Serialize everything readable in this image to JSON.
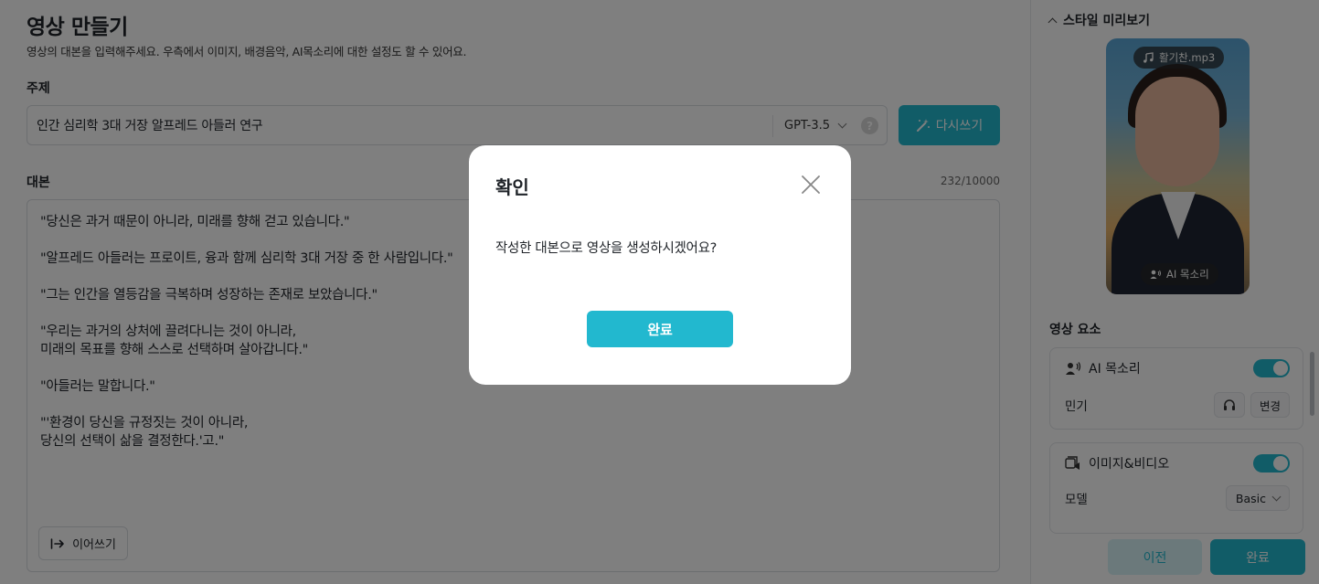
{
  "page": {
    "title": "영상 만들기",
    "description": "영상의 대본을 입력해주세요. 우측에서 이미지, 배경음악, AI목소리에 대한 설정도 할 수 있어요."
  },
  "topic": {
    "label": "주제",
    "value": "인간 심리학 3대 거장 알프레드 아들러 연구",
    "model": "GPT-3.5",
    "help": "?",
    "rewrite_label": "다시쓰기"
  },
  "script": {
    "label": "대본",
    "count": "232/10000",
    "lines": [
      "\"당신은 과거 때문이 아니라, 미래를 향해 걷고 있습니다.\"",
      "",
      "\"알프레드 아들러는 프로이트, 융과 함께 심리학 3대 거장 중 한 사람입니다.\"",
      "",
      "\"그는 인간을 열등감을 극복하며 성장하는 존재로 보았습니다.\"",
      "",
      "\"우리는 과거의 상처에 끌려다니는 것이 아니라,",
      "미래의 목표를 향해 스스로 선택하며 살아갑니다.\"",
      "",
      "\"아들러는 말합니다.\"",
      "",
      "\"'환경이 당신을 규정짓는 것이 아니라,",
      "당신의 선택이 삶을 결정한다.'고.\""
    ],
    "continue_label": "이어쓰기"
  },
  "side": {
    "preview_title": "스타일 미리보기",
    "music_file": "활기찬.mp3",
    "voice_tag": "AI 목소리",
    "elements_title": "영상 요소",
    "voice_card": {
      "title": "AI 목소리",
      "voice_name": "민기",
      "change_label": "변경"
    },
    "image_card": {
      "title": "이미지&비디오",
      "model_label": "모델",
      "model_value": "Basic"
    },
    "prev_label": "이전",
    "done_label": "완료"
  },
  "dialog": {
    "title": "확인",
    "message": "작성한 대본으로 영상을 생성하시겠어요?",
    "confirm_label": "완료"
  },
  "colors": {
    "accent": "#22b8cf",
    "accent_light": "#d6f2f6",
    "overlay": "rgba(0,0,0,0.5)"
  }
}
